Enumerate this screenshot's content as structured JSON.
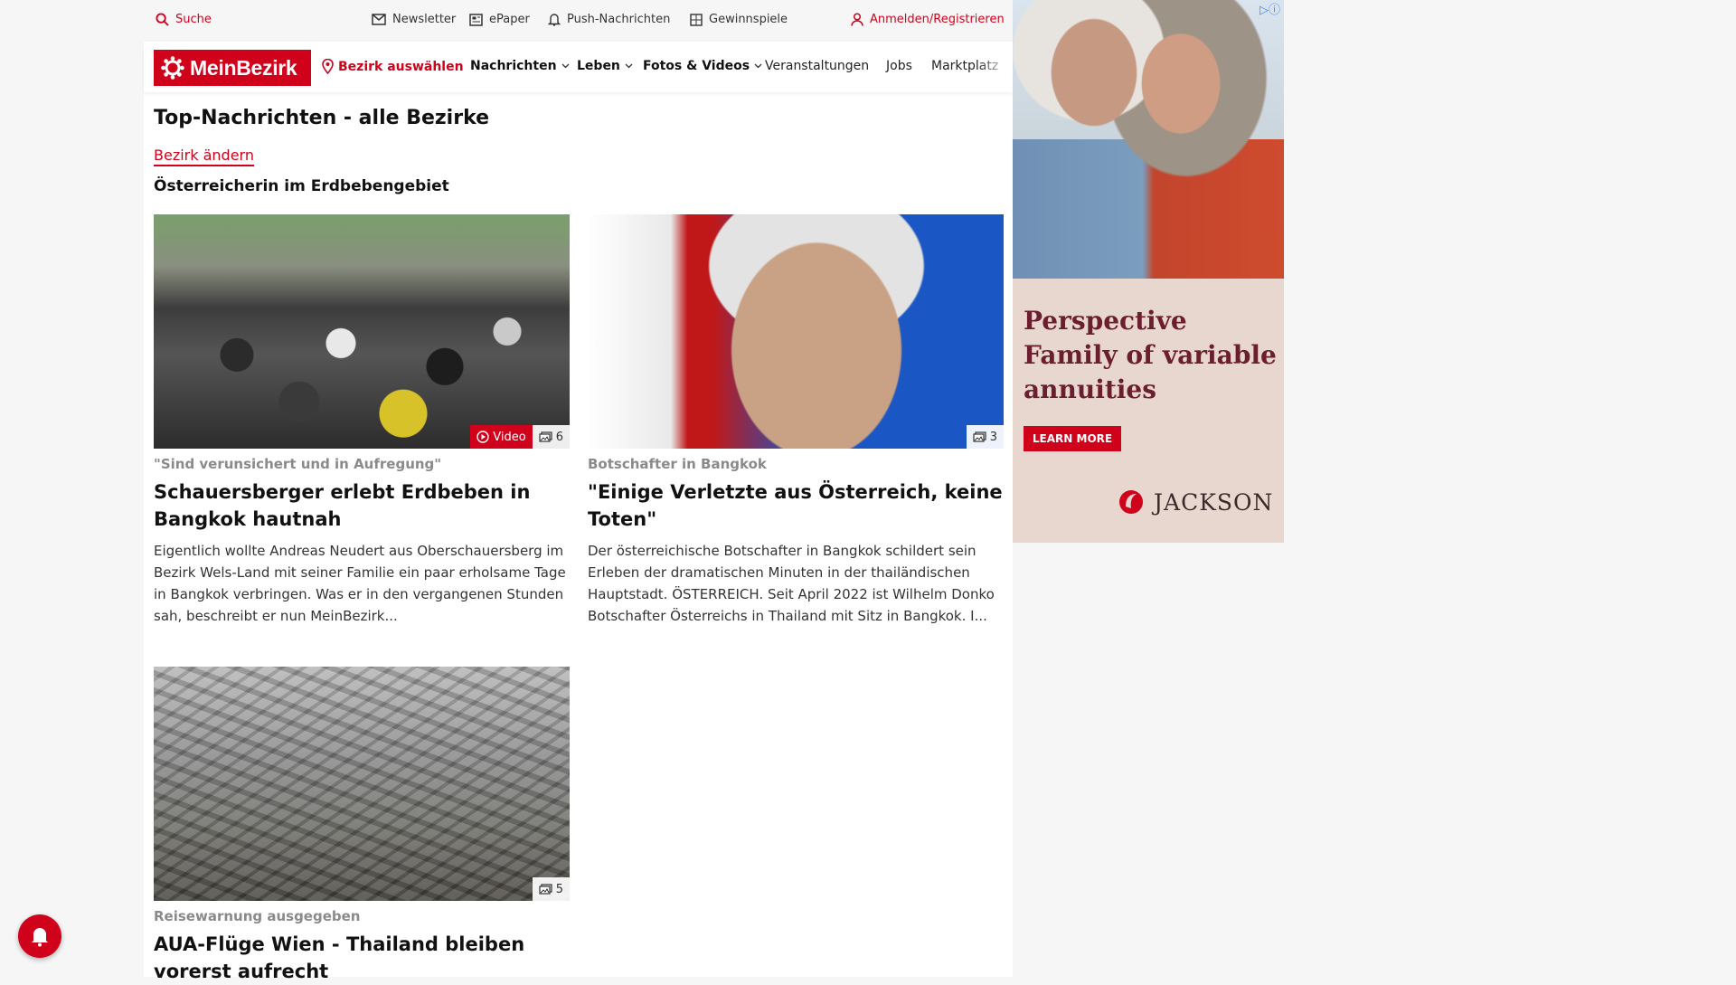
{
  "utility": {
    "search": "Suche",
    "newsletter": "Newsletter",
    "epaper": "ePaper",
    "push": "Push-Nachrichten",
    "games": "Gewinnspiele",
    "login": "Anmelden/Registrieren"
  },
  "nav": {
    "logo": "MeinBezirk",
    "district": "Bezirk auswählen",
    "items": [
      "Nachrichten",
      "Leben",
      "Fotos & Videos",
      "Veranstaltungen",
      "Jobs",
      "Marktplatz"
    ]
  },
  "page": {
    "title": "Top-Nachrichten - alle Bezirke",
    "change_district": "Bezirk ändern",
    "section": "Österreicherin im Erdbebengebiet"
  },
  "articles": [
    {
      "kicker": "\"Sind verunsichert und in Aufregung\"",
      "headline": "Schauersberger erlebt Erdbeben in Bangkok hautnah",
      "teaser": "Eigentlich wollte Andreas Neudert aus Oberschauersberg im Bezirk Wels-Land mit seiner Familie ein paar erholsame Tage in Bangkok verbringen. Was er in den vergangenen Stunden sah, beschreibt er nun MeinBezirk...",
      "video_label": "Video",
      "photo_count": "6"
    },
    {
      "kicker": "Botschafter in Bangkok",
      "headline": "\"Einige Verletzte aus Österreich, keine Toten\"",
      "teaser": "Der österreichische Botschafter in Bangkok schildert sein Erleben der dramatischen Minuten in der thailändischen Hauptstadt. ÖSTERREICH. Seit April 2022 ist Wilhelm Donko Botschafter Österreichs in Thailand mit Sitz in Bangkok. I...",
      "photo_count": "3"
    },
    {
      "kicker": "Reisewarnung ausgegeben",
      "headline": "AUA-Flüge Wien - Thailand bleiben vorerst aufrecht",
      "photo_count": "5"
    }
  ],
  "ad": {
    "headline": "Perspective Family of variable annuities",
    "cta": "LEARN MORE",
    "brand": "JACKSON"
  },
  "colors": {
    "brand_red": "#d0021b",
    "ad_headline": "#6b1e2e"
  }
}
